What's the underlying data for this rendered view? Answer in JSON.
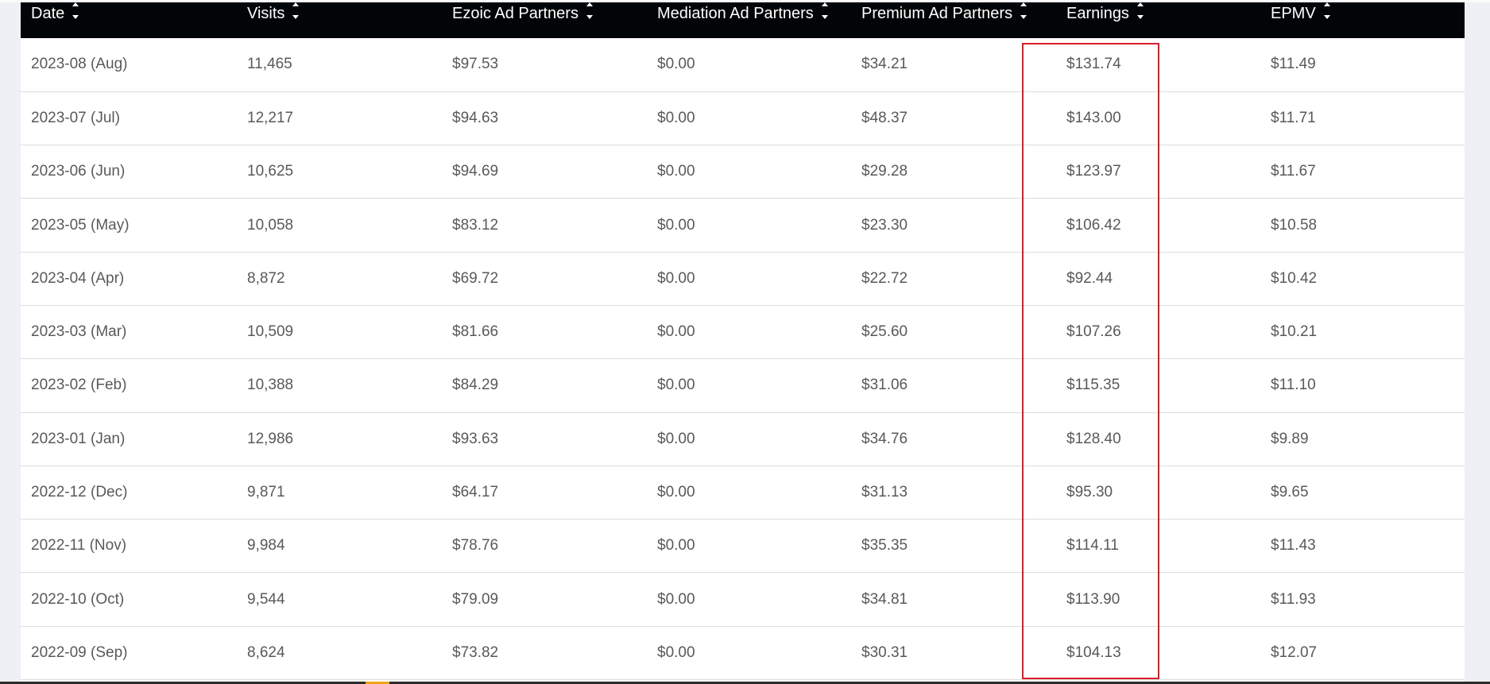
{
  "table": {
    "columns": [
      {
        "label": "Date"
      },
      {
        "label": "Visits"
      },
      {
        "label": "Ezoic Ad Partners"
      },
      {
        "label": "Mediation Ad Partners"
      },
      {
        "label": "Premium Ad Partners"
      },
      {
        "label": "Earnings"
      },
      {
        "label": "EPMV"
      }
    ],
    "rows": [
      [
        "2023-08 (Aug)",
        "11,465",
        "$97.53",
        "$0.00",
        "$34.21",
        "$131.74",
        "$11.49"
      ],
      [
        "2023-07 (Jul)",
        "12,217",
        "$94.63",
        "$0.00",
        "$48.37",
        "$143.00",
        "$11.71"
      ],
      [
        "2023-06 (Jun)",
        "10,625",
        "$94.69",
        "$0.00",
        "$29.28",
        "$123.97",
        "$11.67"
      ],
      [
        "2023-05 (May)",
        "10,058",
        "$83.12",
        "$0.00",
        "$23.30",
        "$106.42",
        "$10.58"
      ],
      [
        "2023-04 (Apr)",
        "8,872",
        "$69.72",
        "$0.00",
        "$22.72",
        "$92.44",
        "$10.42"
      ],
      [
        "2023-03 (Mar)",
        "10,509",
        "$81.66",
        "$0.00",
        "$25.60",
        "$107.26",
        "$10.21"
      ],
      [
        "2023-02 (Feb)",
        "10,388",
        "$84.29",
        "$0.00",
        "$31.06",
        "$115.35",
        "$11.10"
      ],
      [
        "2023-01 (Jan)",
        "12,986",
        "$93.63",
        "$0.00",
        "$34.76",
        "$128.40",
        "$9.89"
      ],
      [
        "2022-12 (Dec)",
        "9,871",
        "$64.17",
        "$0.00",
        "$31.13",
        "$95.30",
        "$9.65"
      ],
      [
        "2022-11 (Nov)",
        "9,984",
        "$78.76",
        "$0.00",
        "$35.35",
        "$114.11",
        "$11.43"
      ],
      [
        "2022-10 (Oct)",
        "9,544",
        "$79.09",
        "$0.00",
        "$34.81",
        "$113.90",
        "$11.93"
      ],
      [
        "2022-09 (Sep)",
        "8,624",
        "$73.82",
        "$0.00",
        "$30.31",
        "$104.13",
        "$12.07"
      ]
    ]
  },
  "icons": {
    "sort": "sort-icon"
  },
  "colors": {
    "header_bg": "#020507",
    "header_text": "#ffffff",
    "cell_text": "#595959",
    "highlight_border": "#d91e2a",
    "page_bg": "#eef0f5"
  }
}
